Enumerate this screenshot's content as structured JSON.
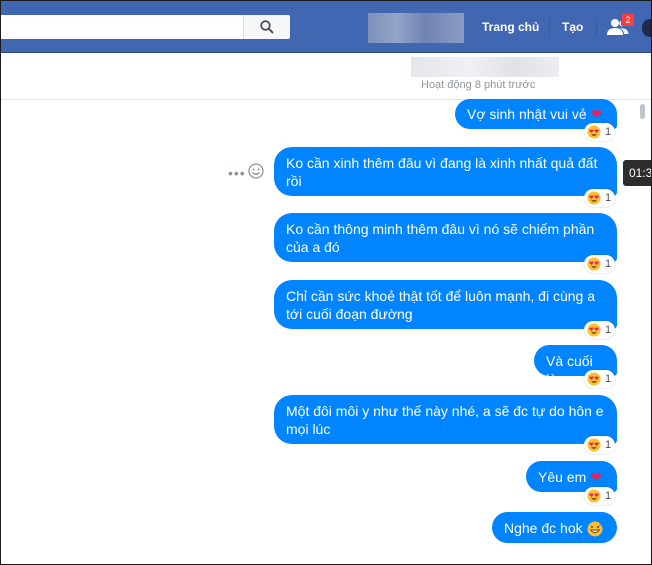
{
  "topbar": {
    "nav_home": "Trang chủ",
    "nav_create": "Tạo",
    "friend_requests_count": "2"
  },
  "conversation": {
    "status": "Hoạt động 8 phút trước"
  },
  "tooltip": {
    "timestamp": "01:3"
  },
  "messages": [
    {
      "text": "Vợ sinh nhật vui vẻ",
      "emoji": "❤",
      "reaction_count": "1"
    },
    {
      "text": "Ko cần xinh thêm đâu vì đang là xinh nhất quả đất rồi",
      "reaction_count": "1"
    },
    {
      "text": "Ko cần thông minh thêm đâu vì nó sẽ chiếm phần của a đó",
      "reaction_count": "1"
    },
    {
      "text": "Chỉ cần sức khoẻ thật tốt để luôn mạnh, đi cùng a tới cuối đoạn đường",
      "reaction_count": "1"
    },
    {
      "text": "Và cuối là",
      "reaction_count": "1"
    },
    {
      "text": "Một đôi môi y như thế này nhé, a sẽ đc tự do hôn e mọi lúc",
      "reaction_count": "1"
    },
    {
      "text": "Yêu em",
      "emoji": "❤",
      "reaction_count": "1"
    },
    {
      "text": "Nghe đc hok"
    }
  ],
  "colors": {
    "topbar": "#4267b2",
    "bubble": "#0084ff",
    "heart": "#e0245e"
  },
  "icons": {
    "search": "search-icon",
    "friends": "friends-icon",
    "more": "more-options-icon",
    "react": "smiley-icon",
    "reaction": "heart-eyes-emoji",
    "sent_emoji": "grinning-sweat-emoji"
  }
}
